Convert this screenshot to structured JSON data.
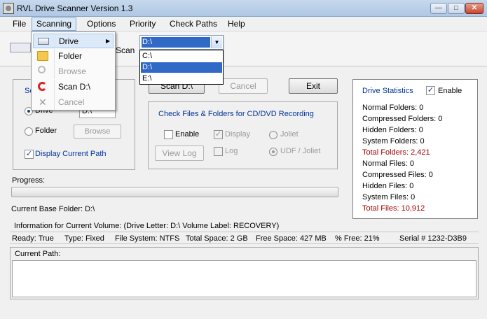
{
  "window": {
    "title": "RVL Drive Scanner Version 1.3"
  },
  "menubar": {
    "items": [
      "File",
      "Scanning",
      "Options",
      "Priority",
      "Check Paths",
      "Help"
    ]
  },
  "scanning_menu": {
    "items": [
      {
        "label": "Drive",
        "icon": "drive-icon",
        "enabled": true,
        "submenu": true
      },
      {
        "label": "Folder",
        "icon": "folder-icon",
        "enabled": true
      },
      {
        "label": "Browse",
        "icon": "magnifier-icon",
        "enabled": false
      },
      {
        "label": "Scan D:\\",
        "icon": "refresh-icon",
        "enabled": true
      },
      {
        "label": "Cancel",
        "icon": "x-icon",
        "enabled": false
      }
    ],
    "submenu_arrow": "▶"
  },
  "drive_combo": {
    "value": "D:\\",
    "options": [
      "C:\\",
      "D:\\",
      "E:\\"
    ],
    "selected_index": 1
  },
  "toolbar": {
    "partial_text": "Scan"
  },
  "select_group": {
    "title_partial": "Se",
    "drive_label": "Drive",
    "drive_value": "D:\\",
    "folder_label": "Folder",
    "browse_button": "Browse",
    "display_path_label": "Display Current Path",
    "drive_selected": true,
    "display_path_checked": true
  },
  "actions": {
    "scan": "Scan D:\\",
    "cancel": "Cancel",
    "exit": "Exit"
  },
  "cd_group": {
    "title": "Check Files &  Folders for CD/DVD Recording",
    "enable": "Enable",
    "display": "Display",
    "joliet": "Joliet",
    "log": "Log",
    "udf": "UDF / Joliet",
    "view_log": "View Log"
  },
  "progress": {
    "label": "Progress:",
    "value": 0
  },
  "current_base": "Current Base Folder: D:\\",
  "volume_info": {
    "header": "Information for Current Volume:  (Drive Letter: D:\\   Volume Label: RECOVERY)",
    "ready": "Ready: True",
    "type": "Type: Fixed",
    "fs": "File System: NTFS",
    "total": "Total Space: 2 GB",
    "free": "Free Space: 427 MB",
    "pct_free": "% Free: 21%",
    "serial": "Serial # 1232-D3B9"
  },
  "current_path": {
    "label": "Current Path:",
    "value": ""
  },
  "stats": {
    "title": "Drive Statistics",
    "enable": "Enable",
    "enabled": true,
    "lines": [
      {
        "text": "Normal Folders: 0",
        "highlight": false
      },
      {
        "text": "Compressed Folders: 0",
        "highlight": false
      },
      {
        "text": "Hidden Folders: 0",
        "highlight": false
      },
      {
        "text": "System Folders: 0",
        "highlight": false
      },
      {
        "text": "Total Folders: 2,421",
        "highlight": true
      },
      {
        "text": "Normal Files: 0",
        "highlight": false
      },
      {
        "text": "Compressed Files: 0",
        "highlight": false
      },
      {
        "text": "Hidden Files: 0",
        "highlight": false
      },
      {
        "text": "System Files: 0",
        "highlight": false
      },
      {
        "text": "Total Files: 10,912",
        "highlight": true
      }
    ]
  },
  "colors": {
    "accent_blue": "#003399",
    "highlight_red": "#a00000",
    "selection": "#3169c6"
  }
}
